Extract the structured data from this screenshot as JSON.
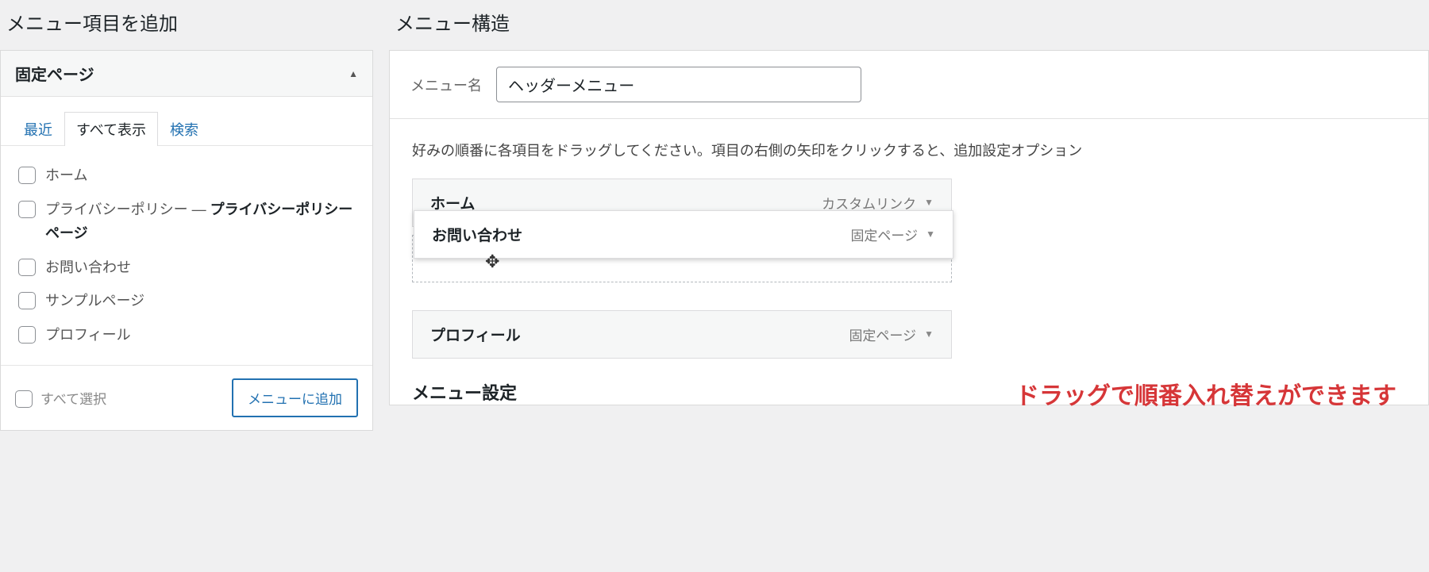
{
  "left": {
    "title": "メニュー項目を追加",
    "accordion": {
      "label": "固定ページ"
    },
    "tabs": {
      "recent": "最近",
      "all": "すべて表示",
      "search": "検索"
    },
    "pages": {
      "home": "ホーム",
      "privacy_prefix": "プライバシーポリシー — ",
      "privacy_bold": "プライバシーポリシーページ",
      "contact": "お問い合わせ",
      "sample": "サンプルページ",
      "profile": "プロフィール"
    },
    "select_all": "すべて選択",
    "add_button": "メニューに追加"
  },
  "right": {
    "title": "メニュー構造",
    "menu_name_label": "メニュー名",
    "menu_name_value": "ヘッダーメニュー",
    "instructions": "好みの順番に各項目をドラッグしてください。項目の右側の矢印をクリックすると、追加設定オプション",
    "items": {
      "home": {
        "label": "ホーム",
        "type": "カスタムリンク"
      },
      "contact": {
        "label": "お問い合わせ",
        "type": "固定ページ"
      },
      "profile": {
        "label": "プロフィール",
        "type": "固定ページ"
      }
    },
    "callout": "ドラッグで順番入れ替えができます",
    "settings_title": "メニュー設定"
  }
}
